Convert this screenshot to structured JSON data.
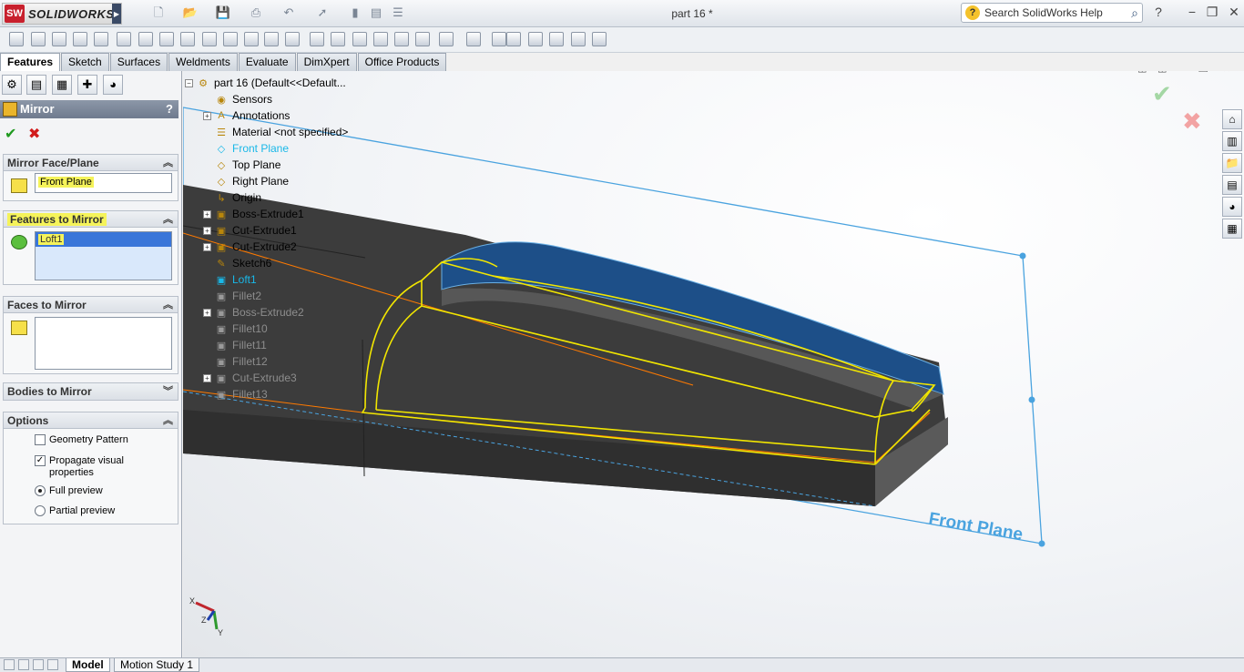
{
  "app": {
    "logo_badge": "SW",
    "logo_text": "SOLIDWORKS",
    "document_title": "part 16 *"
  },
  "search": {
    "placeholder": "Search SolidWorks Help"
  },
  "tabs": [
    {
      "label": "Features",
      "active": true
    },
    {
      "label": "Sketch"
    },
    {
      "label": "Surfaces"
    },
    {
      "label": "Weldments"
    },
    {
      "label": "Evaluate"
    },
    {
      "label": "DimXpert"
    },
    {
      "label": "Office Products"
    }
  ],
  "property_manager": {
    "title": "Mirror",
    "help": "?",
    "mirror_face_plane": {
      "heading": "Mirror Face/Plane",
      "value": "Front Plane"
    },
    "features_to_mirror": {
      "heading": "Features to Mirror",
      "items": [
        "Loft1"
      ]
    },
    "faces_to_mirror": {
      "heading": "Faces to Mirror"
    },
    "bodies_to_mirror": {
      "heading": "Bodies to Mirror"
    },
    "options": {
      "heading": "Options",
      "geometry_pattern": "Geometry Pattern",
      "propagate_visual": "Propagate visual properties",
      "full_preview": "Full preview",
      "partial_preview": "Partial preview"
    }
  },
  "feature_tree": {
    "root": "part 16  (Default<<Default...",
    "items": [
      {
        "label": "Sensors",
        "style": "normal"
      },
      {
        "label": "Annotations",
        "style": "normal",
        "expandable": true
      },
      {
        "label": "Material <not specified>",
        "style": "normal"
      },
      {
        "label": "Front Plane",
        "style": "blue"
      },
      {
        "label": "Top Plane",
        "style": "normal"
      },
      {
        "label": "Right Plane",
        "style": "normal"
      },
      {
        "label": "Origin",
        "style": "normal"
      },
      {
        "label": "Boss-Extrude1",
        "style": "normal",
        "expandable": true
      },
      {
        "label": "Cut-Extrude1",
        "style": "normal",
        "expandable": true
      },
      {
        "label": "Cut-Extrude2",
        "style": "normal",
        "expandable": true
      },
      {
        "label": "Sketch6",
        "style": "normal"
      },
      {
        "label": "Loft1",
        "style": "blue"
      },
      {
        "label": "Fillet2",
        "style": "dim"
      },
      {
        "label": "Boss-Extrude2",
        "style": "dim",
        "expandable": true
      },
      {
        "label": "Fillet10",
        "style": "dim"
      },
      {
        "label": "Fillet11",
        "style": "dim"
      },
      {
        "label": "Fillet12",
        "style": "dim"
      },
      {
        "label": "Cut-Extrude3",
        "style": "dim",
        "expandable": true
      },
      {
        "label": "Fillet13",
        "style": "dim"
      }
    ]
  },
  "viewport": {
    "plane_label": "Front Plane",
    "triad": {
      "x": "X",
      "y": "Y",
      "z": "Z"
    }
  },
  "bottom_tabs": [
    {
      "label": "Model",
      "active": true
    },
    {
      "label": "Motion Study 1"
    }
  ],
  "colors": {
    "accent": "#3a76d9",
    "plane": "#4aa3df",
    "highlight": "#f5f35a",
    "model": "#3d3d3d",
    "preview": "#f2e600",
    "edge_orange": "#ff7a00"
  }
}
